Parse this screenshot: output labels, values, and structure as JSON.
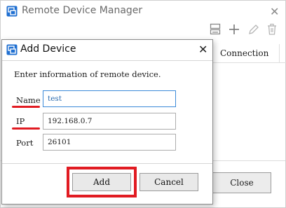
{
  "background_window": {
    "title": "Remote Device Manager",
    "close_glyph": "✕",
    "toolbar": [
      {
        "icon": "device-icon"
      },
      {
        "icon": "plus-icon"
      },
      {
        "icon": "pencil-icon"
      },
      {
        "icon": "trash-icon"
      }
    ],
    "column_header": "Connection",
    "close_button": "Close"
  },
  "dialog": {
    "title": "Add Device",
    "close_glyph": "✕",
    "instruction": "Enter information of remote device.",
    "fields": {
      "name": {
        "label": "Name",
        "value": "test"
      },
      "ip": {
        "label": "IP",
        "value": "192.168.0.7"
      },
      "port": {
        "label": "Port",
        "value": "26101"
      }
    },
    "add_button": "Add",
    "cancel_button": "Cancel"
  },
  "annotation_color": "#e11b22"
}
